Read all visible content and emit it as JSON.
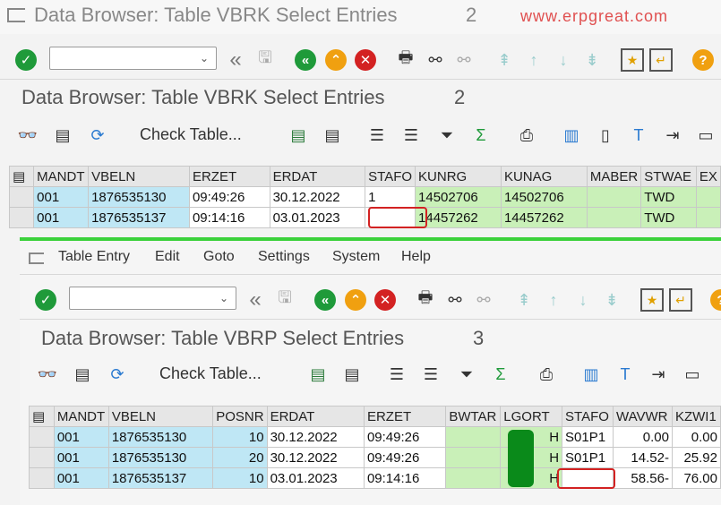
{
  "window1": {
    "title": "Data Browser: Table VBRK Select Entries",
    "count": "2",
    "watermark": "www.erpgreat.com"
  },
  "toolbar": {
    "confirm_icon": "check-circle-icon",
    "command_placeholder": "",
    "back_icon": "double-chevron-left-icon",
    "save_icon": "save-icon",
    "exit_icon": "back-circle-icon",
    "cancel_icon": "up-chevron-icon",
    "close_icon": "cancel-x-icon",
    "print_icon": "printer-icon",
    "find_icon": "binoculars-icon",
    "help_label": "?"
  },
  "screen1": {
    "title": "Data Browser: Table VBRK Select Entries",
    "count": "2",
    "check_table_label": "Check Table...",
    "columns": [
      "MANDT",
      "VBELN",
      "ERZET",
      "ERDAT",
      "STAFO",
      "KUNRG",
      "KUNAG",
      "MABER",
      "STWAE",
      "EX"
    ],
    "rows": [
      {
        "mandt": "001",
        "vbeln": "1876535130",
        "erzet": "09:49:26",
        "erdat": "30.12.2022",
        "stafo": "1",
        "kunrg": "14502706",
        "kunag": "14502706",
        "maber": "",
        "stwae": "TWD"
      },
      {
        "mandt": "001",
        "vbeln": "1876535137",
        "erzet": "09:14:16",
        "erdat": "03.01.2023",
        "stafo": "",
        "kunrg": "14457262",
        "kunag": "14457262",
        "maber": "",
        "stwae": "TWD"
      }
    ]
  },
  "menu": {
    "items": [
      "Table Entry",
      "Edit",
      "Goto",
      "Settings",
      "System",
      "Help"
    ]
  },
  "screen2": {
    "title": "Data Browser: Table VBRP Select Entries",
    "count": "3",
    "check_table_label": "Check Table...",
    "columns": [
      "MANDT",
      "VBELN",
      "POSNR",
      "ERDAT",
      "ERZET",
      "BWTAR",
      "LGORT",
      "STAFO",
      "WAVWR",
      "KZWI1"
    ],
    "rows": [
      {
        "mandt": "001",
        "vbeln": "1876535130",
        "posnr": "10",
        "erdat": "30.12.2022",
        "erzet": "09:49:26",
        "bwtar": "",
        "lgort": "H",
        "stafo": "S01P1",
        "wavwr": "0.00",
        "kzwi1": "0.00"
      },
      {
        "mandt": "001",
        "vbeln": "1876535130",
        "posnr": "20",
        "erdat": "30.12.2022",
        "erzet": "09:49:26",
        "bwtar": "",
        "lgort": "H",
        "stafo": "S01P1",
        "wavwr": "14.52-",
        "kzwi1": "25.92"
      },
      {
        "mandt": "001",
        "vbeln": "1876535137",
        "posnr": "10",
        "erdat": "03.01.2023",
        "erzet": "09:14:16",
        "bwtar": "",
        "lgort": "H",
        "stafo": "",
        "wavwr": "58.56-",
        "kzwi1": "76.00"
      }
    ]
  }
}
